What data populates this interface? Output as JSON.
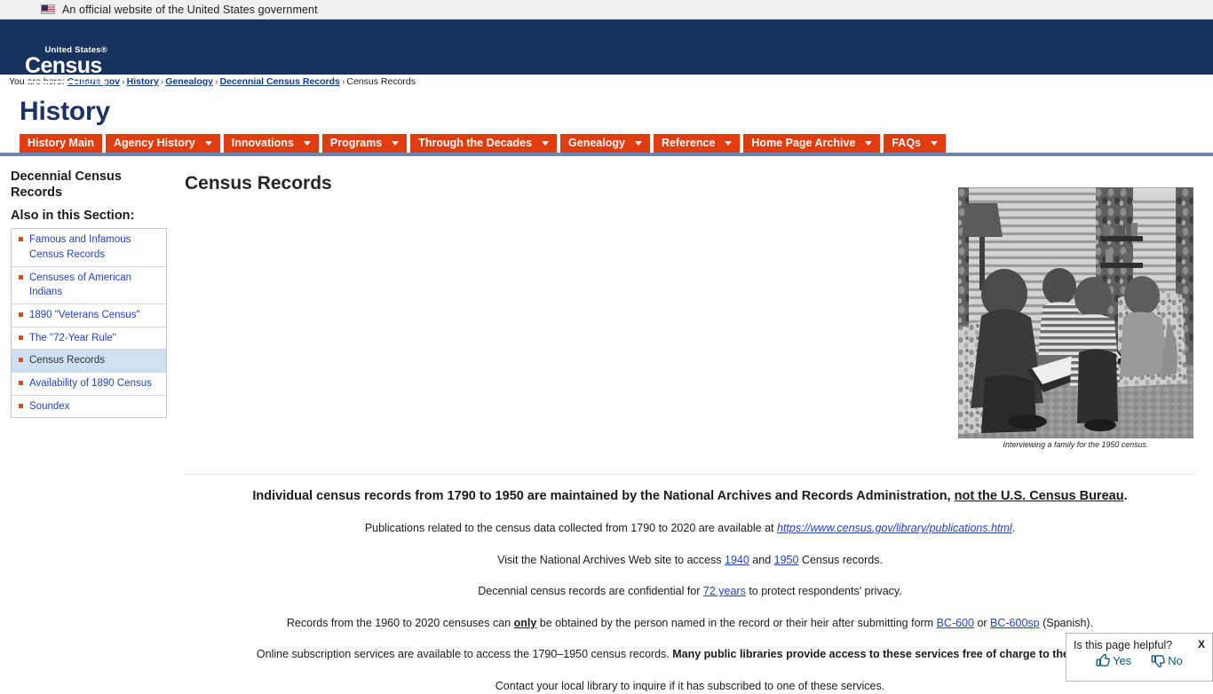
{
  "gov_banner": {
    "text": "An official website of the United States government",
    "flag_icon": "us-flag-icon"
  },
  "header": {
    "logo_united_states": "United States®",
    "logo_census": "Census",
    "logo_bureau": "Bureau"
  },
  "breadcrumb": {
    "label": "You are here:",
    "items": [
      {
        "text": "Census.gov",
        "link": true
      },
      {
        "text": "History",
        "link": true
      },
      {
        "text": "Genealogy",
        "link": true
      },
      {
        "text": "Decennial Census Records",
        "link": true
      },
      {
        "text": "Census Records",
        "link": false
      }
    ],
    "separator": "›"
  },
  "section_title": "History",
  "nav": {
    "items": [
      {
        "label": "History Main",
        "caret": false
      },
      {
        "label": "Agency History",
        "caret": true
      },
      {
        "label": "Innovations",
        "caret": true
      },
      {
        "label": "Programs",
        "caret": true
      },
      {
        "label": "Through the Decades",
        "caret": true
      },
      {
        "label": "Genealogy",
        "caret": true
      },
      {
        "label": "Reference",
        "caret": true
      },
      {
        "label": "Home Page Archive",
        "caret": true
      },
      {
        "label": "FAQs",
        "caret": true
      }
    ],
    "accent_color": "#e03c0f",
    "underline_color": "#6b85ad"
  },
  "sidebar": {
    "title": "Decennial Census Records",
    "subtitle": "Also in this Section:",
    "items": [
      {
        "label": "Famous and Infamous Census Records",
        "active": false
      },
      {
        "label": "Censuses of American Indians",
        "active": false
      },
      {
        "label": "1890 \"Veterans Census\"",
        "active": false
      },
      {
        "label": "The \"72-Year Rule\"",
        "active": false
      },
      {
        "label": "Census Records",
        "active": true
      },
      {
        "label": "Availability of 1890 Census",
        "active": false
      },
      {
        "label": "Soundex",
        "active": false
      }
    ],
    "bullet_color": "#d94e1f",
    "active_bg": "#cfe0f2"
  },
  "main": {
    "title": "Census Records",
    "photo_caption": "Interviewing a family for the 1950 census.",
    "photo_alt": "Census taker interviewing a family in a living room, 1950",
    "lede": {
      "before": "Individual census records from 1790 to 1950 are maintained by the National Archives and Records Administration, ",
      "underlined": "not the U.S. Census Bureau",
      "after": "."
    },
    "paragraphs": [
      {
        "id": "publications",
        "before": "Publications related to the census data collected from 1790 to 2020 are available at ",
        "link": "https://www.census.gov/library/publications.html",
        "after": "."
      },
      {
        "id": "national-archives",
        "before": "Visit the National Archives Web site to access ",
        "link1": "1940",
        "middle": " and ",
        "link2": "1950",
        "after": " Census records."
      },
      {
        "id": "confidential",
        "before": "Decennial census records are confidential for ",
        "link": "72 years",
        "after": " to protect respondents' privacy."
      },
      {
        "id": "bc600",
        "before": "Records from the 1960 to 2020 censuses can ",
        "emphasis": "only",
        "middle": " be obtained by the person named in the record or their heir after submitting form ",
        "link1": "BC-600",
        "middle2": " or ",
        "link2": "BC-600sp",
        "after": " (Spanish)."
      },
      {
        "id": "subscription",
        "before": "Online subscription services are available to access the 1790–1950 census records. ",
        "bold": "Many public libraries provide access to these services free of charge to their patrons."
      },
      {
        "id": "local-library",
        "text": "Contact your local library to inquire if it has subscribed to one of these services."
      }
    ]
  },
  "feedback": {
    "question": "Is this page helpful?",
    "close_label": "X",
    "yes_label": "Yes",
    "no_label": "No",
    "thumbs_up_icon": "thumbs-up-icon",
    "thumbs_down_icon": "thumbs-down-icon",
    "accent_color": "#0c5d83"
  }
}
